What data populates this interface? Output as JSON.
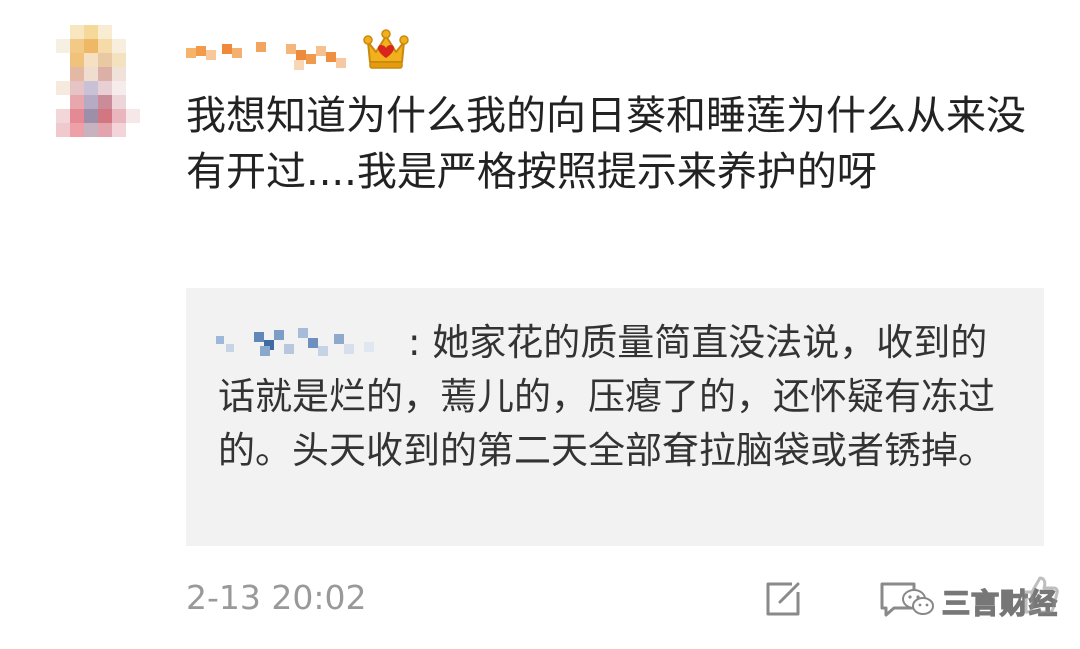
{
  "comment": {
    "text": "我想知道为什么我的向日葵和睡莲为什么从来没有开过....我是严格按照提示来养护的呀",
    "timestamp": "2-13 20:02",
    "user_badge_icon": "crown-icon"
  },
  "quote": {
    "text": ": 她家花的质量简直没法说，收到的话就是烂的，蔫儿的，压瘪了的，还怀疑有冻过的。头天收到的第二天全部耷拉脑袋或者锈掉。"
  },
  "watermark": {
    "text": "三言财经"
  },
  "colors": {
    "background": "#ffffff",
    "quote_background": "#f2f2f2",
    "timestamp": "#999999",
    "crown": "#e8a317",
    "crown_gem": "#d9261c"
  }
}
